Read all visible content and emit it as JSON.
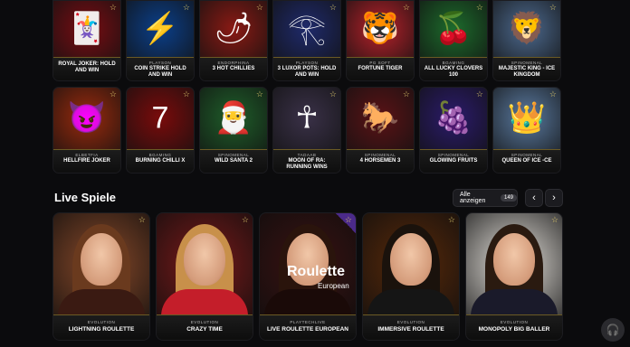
{
  "slots_row1": [
    {
      "provider": "",
      "name": "ROYAL JOKER: HOLD AND WIN",
      "icon": "jester-icon",
      "glyph": "🃏",
      "bg": "#7a0d12"
    },
    {
      "provider": "PLAYSON",
      "name": "COIN STRIKE HOLD AND WIN",
      "icon": "lightning-coin-icon",
      "glyph": "⚡",
      "bg": "#0b3f8a"
    },
    {
      "provider": "ENDORPHINA",
      "name": "3 HOT CHILLIES",
      "icon": "mariachi-icon",
      "glyph": "🌶",
      "bg": "#8a1a14"
    },
    {
      "provider": "PLAYSON",
      "name": "3 LUXOR POTS: HOLD AND WIN",
      "icon": "pharaoh-icon",
      "glyph": "𓂀",
      "bg": "#1f2a6b"
    },
    {
      "provider": "PG SOFT",
      "name": "FORTUNE TIGER",
      "icon": "tiger-icon",
      "glyph": "🐯",
      "bg": "#b8212a"
    },
    {
      "provider": "BGAMING",
      "name": "ALL LUCKY CLOVERS 100",
      "icon": "cherries-icon",
      "glyph": "🍒",
      "bg": "#1d6b2c"
    },
    {
      "provider": "SPINOMENAL",
      "name": "MAJESTIC KING - ICE KINGDOM",
      "icon": "lion-icon",
      "glyph": "🦁",
      "bg": "#4d6a8f"
    }
  ],
  "slots_row2": [
    {
      "provider": "ELBETFIA",
      "name": "HELLFIRE JOKER",
      "icon": "devil-jester-icon",
      "glyph": "😈",
      "bg": "#9a2a0c"
    },
    {
      "provider": "BGAMING",
      "name": "BURNING CHILLI X",
      "icon": "seven-icon",
      "glyph": "7",
      "bg": "#7a0b0b"
    },
    {
      "provider": "SPINOMENAL",
      "name": "WILD SANTA 2",
      "icon": "santa-icon",
      "glyph": "🎅",
      "bg": "#1f5e2a"
    },
    {
      "provider": "TADAAB",
      "name": "MOON OF RA: RUNNING WINS",
      "icon": "anubis-icon",
      "glyph": "☥",
      "bg": "#3a3148"
    },
    {
      "provider": "SPINOMENAL",
      "name": "4 HORSEMEN 3",
      "icon": "horseman-icon",
      "glyph": "🐎",
      "bg": "#5a1216"
    },
    {
      "provider": "SPINOMENAL",
      "name": "GLOWING FRUITS",
      "icon": "fruits-icon",
      "glyph": "🍇",
      "bg": "#2b1b6b"
    },
    {
      "provider": "SPINOMENAL",
      "name": "QUEEN OF ICE -CE",
      "icon": "ice-queen-icon",
      "glyph": "👑",
      "bg": "#5a7aa0"
    }
  ],
  "live": {
    "title": "Live Spiele",
    "all_label": "Alle anzeigen",
    "count": "149",
    "prev": "‹",
    "next": "›",
    "cards": [
      {
        "provider": "EVOLUTION",
        "name": "LIGHTNING ROULETTE",
        "bg": "#8a4a2a",
        "hair": "#6a3a1e",
        "torso": "#3a1a12"
      },
      {
        "provider": "EVOLUTION",
        "name": "CRAZY TIME",
        "bg": "#7a1a1a",
        "hair": "#c8904a",
        "torso": "#c41e2a"
      },
      {
        "provider": "PLAYTECHLIVE",
        "name": "LIVE ROULETTE EUROPEAN",
        "bg": "#3a1212",
        "hair": "#2a140c",
        "torso": "#1a0a08",
        "overlay_title": "Roulette",
        "overlay_sub": "European"
      },
      {
        "provider": "EVOLUTION",
        "name": "IMMERSIVE ROULETTE",
        "bg": "#5a2a0a",
        "hair": "#1a120c",
        "torso": "#151515"
      },
      {
        "provider": "EVOLUTION",
        "name": "MONOPOLY BIG BALLER",
        "bg": "#e8e4de",
        "hair": "#2a1a10",
        "torso": "#1a1a2a"
      }
    ]
  },
  "support": {
    "icon": "headset-icon",
    "glyph": "🎧"
  },
  "favorite_glyph": "☆"
}
